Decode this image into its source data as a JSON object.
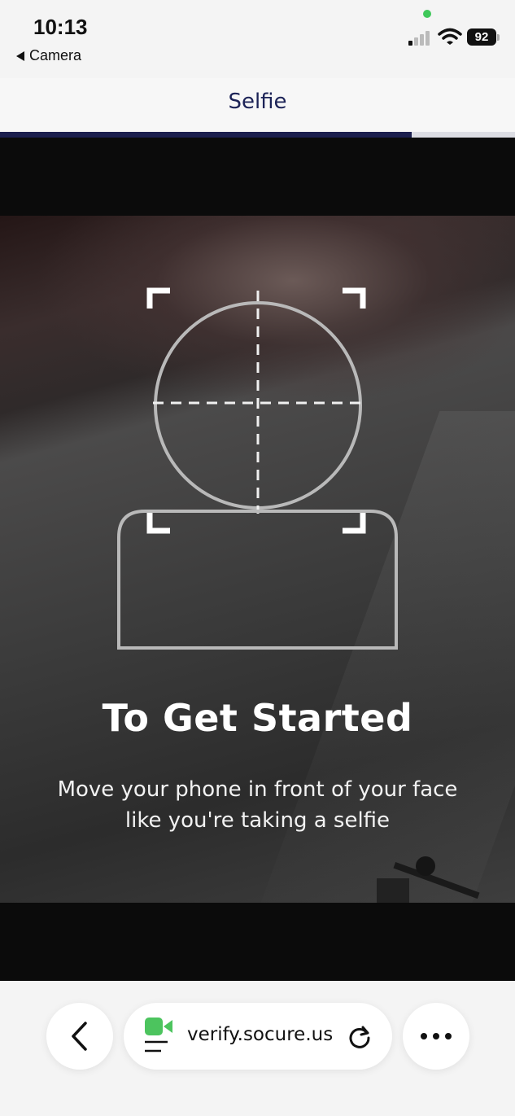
{
  "status_bar": {
    "time": "10:13",
    "back_app_label": "Camera",
    "battery_level": "92",
    "signal_icon": "cellular-signal-icon",
    "wifi_icon": "wifi-icon",
    "camera_indicator_color": "#3fc85a"
  },
  "header": {
    "title": "Selfie",
    "progress_fraction": 0.8,
    "progress_color": "#1c1f4e"
  },
  "camera": {
    "headline": "To Get Started",
    "instruction_line1": "Move your phone in front of your face",
    "instruction_line2": "like you're taking a selfie",
    "guide_icon": "face-guide-icon",
    "guide_color": "#b9b9b9"
  },
  "browser_bar": {
    "url": "verify.socure.us",
    "back_icon": "chevron-left-icon",
    "reload_icon": "reload-icon",
    "more_icon": "more-dots-icon",
    "camera_active_icon": "video-camera-icon",
    "camera_active_color": "#4cc45e"
  }
}
